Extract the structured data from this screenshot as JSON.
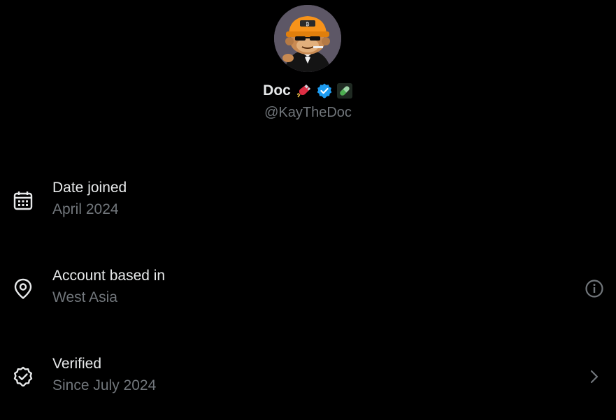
{
  "profile": {
    "display_name": "Doc",
    "handle": "@KayTheDoc",
    "badges": [
      "magnet-emoji",
      "verified-badge",
      "pill-emoji"
    ]
  },
  "details": [
    {
      "title": "Date joined",
      "value": "April 2024",
      "icon": "calendar-icon"
    },
    {
      "title": "Account based in",
      "value": "West Asia",
      "icon": "location-pin-icon",
      "trailing_icon": "info-icon"
    },
    {
      "title": "Verified",
      "value": "Since July 2024",
      "icon": "verified-check-icon",
      "trailing_icon": "chevron-right-icon"
    }
  ],
  "colors": {
    "background": "#000000",
    "primary_text": "#e7e9ea",
    "secondary_text": "#71767b",
    "verified_blue": "#1d9bf0"
  }
}
